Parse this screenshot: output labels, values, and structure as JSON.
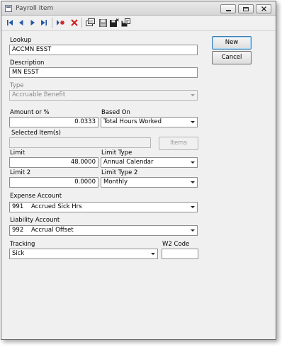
{
  "window": {
    "title": "Payroll Item"
  },
  "toolbar": {
    "icons": [
      "first-record-icon",
      "previous-record-icon",
      "next-record-icon",
      "last-record-icon",
      "new-record-icon",
      "delete-icon",
      "find-icon",
      "save-icon",
      "save-close-icon",
      "save-new-icon"
    ]
  },
  "buttons": {
    "new": "New",
    "cancel": "Cancel",
    "items": "Items"
  },
  "fields": {
    "lookup": {
      "label": "Lookup",
      "value": "ACCMN ESST"
    },
    "description": {
      "label": "Description",
      "value": "MN ESST"
    },
    "type": {
      "label": "Type",
      "value": "Accruable Benefit"
    },
    "amount": {
      "label": "Amount or %",
      "value": "0.0333"
    },
    "based_on": {
      "label": "Based On",
      "value": "Total Hours Worked"
    },
    "selected_items": {
      "label": "Selected Item(s)",
      "value": ""
    },
    "limit": {
      "label": "Limit",
      "value": "48.0000"
    },
    "limit_type": {
      "label": "Limit Type",
      "value": "Annual Calendar"
    },
    "limit2": {
      "label": "Limit 2",
      "value": "0.0000"
    },
    "limit_type2": {
      "label": "Limit Type 2",
      "value": "Monthly"
    },
    "expense_account": {
      "label": "Expense Account",
      "code": "991",
      "name": "Accrued Sick Hrs"
    },
    "liability_account": {
      "label": "Liability Account",
      "code": "992",
      "name": "Accrual Offset"
    },
    "tracking": {
      "label": "Tracking",
      "value": "Sick"
    },
    "w2_code": {
      "label": "W2 Code",
      "value": ""
    }
  },
  "colors": {
    "nav_blue": "#2457a6",
    "delete_red": "#d11b1b"
  }
}
